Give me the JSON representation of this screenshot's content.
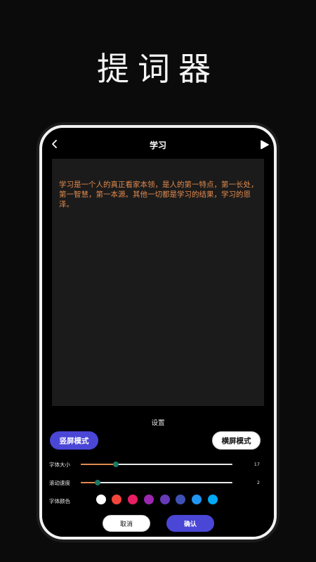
{
  "promo": {
    "title": "提词器"
  },
  "topbar": {
    "title": "学习"
  },
  "script_text": "学习是一个人的真正看家本领，是人的第一特点，第一长处，第一智慧，第一本源。其他一切都是学习的结果，学习的恩泽。",
  "settings": {
    "title": "设置",
    "mode_portrait": "竖屏模式",
    "mode_landscape": "横屏模式",
    "font_size": {
      "label": "字体大小",
      "value": "17",
      "level": 0.23
    },
    "scroll_speed": {
      "label": "滚动速度",
      "value": "2",
      "level": 0.11
    },
    "font_color": {
      "label": "字体颜色",
      "colors": [
        "#000000",
        "#ffffff",
        "#f4453c",
        "#e91e63",
        "#9c27b0",
        "#673ab7",
        "#3f51b5",
        "#2196f3",
        "#03a9f4"
      ]
    },
    "cancel": "取消",
    "confirm": "确认"
  },
  "colors": {
    "accent": "#4a46d6",
    "text_orange": "#e08a4e",
    "thumb": "#1d7a66"
  },
  "icons": {
    "back": "chevron-left-icon",
    "play": "play-icon"
  }
}
